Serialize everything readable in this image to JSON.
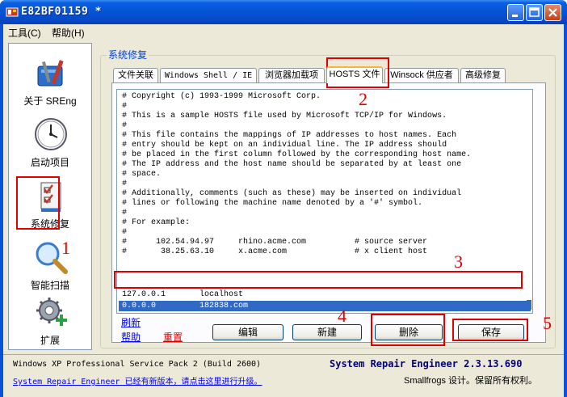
{
  "window": {
    "title": "E82BF01159 *",
    "colors": {
      "titlebar": "#0553d6",
      "accent_red": "#e00000",
      "selection": "#316ac5"
    }
  },
  "menubar": {
    "items": [
      "工具(C)",
      "帮助(H)"
    ]
  },
  "nav": {
    "items": [
      {
        "label": "关于 SREng",
        "icon": "toolbox-icon"
      },
      {
        "label": "启动项目",
        "icon": "clock-icon"
      },
      {
        "label": "系统修复",
        "icon": "checklist-icon"
      },
      {
        "label": "智能扫描",
        "icon": "magnifier-icon"
      },
      {
        "label": "扩展",
        "icon": "gear-plus-icon"
      }
    ]
  },
  "group": {
    "title": "系统修复"
  },
  "tabs": [
    "文件关联",
    "Windows Shell / IE",
    "浏览器加载项",
    "HOSTS 文件",
    "Winsock 供应者",
    "高级修复"
  ],
  "active_tab": "HOSTS 文件",
  "hosts": {
    "lines": [
      "# Copyright (c) 1993-1999 Microsoft Corp.",
      "#",
      "# This is a sample HOSTS file used by Microsoft TCP/IP for Windows.",
      "#",
      "# This file contains the mappings of IP addresses to host names. Each",
      "# entry should be kept on an individual line. The IP address should",
      "# be placed in the first column followed by the corresponding host name.",
      "# The IP address and the host name should be separated by at least one",
      "# space.",
      "#",
      "# Additionally, comments (such as these) may be inserted on individual",
      "# lines or following the machine name denoted by a '#' symbol.",
      "#",
      "# For example:",
      "#",
      "#      102.54.94.97     rhino.acme.com          # source server",
      "#       38.25.63.10     x.acme.com              # x client host",
      "",
      "127.0.0.1       localhost"
    ],
    "selected_line": "0.0.0.0         182838.com"
  },
  "links": {
    "refresh": "刷新",
    "help": "帮助",
    "reset": "重置"
  },
  "buttons": {
    "edit": "编辑",
    "new": "新建",
    "delete": "删除",
    "save": "保存"
  },
  "annotations": [
    "1",
    "2",
    "3",
    "4",
    "5"
  ],
  "footer": {
    "os": "Windows XP Professional Service Pack 2 (Build 2600)",
    "update_link": "System Repair Engineer 已经有新版本，请点击这里进行升级。",
    "app_title": "System Repair Engineer 2.3.13.690",
    "copyright": "Smallfrogs 设计。保留所有权利。"
  }
}
